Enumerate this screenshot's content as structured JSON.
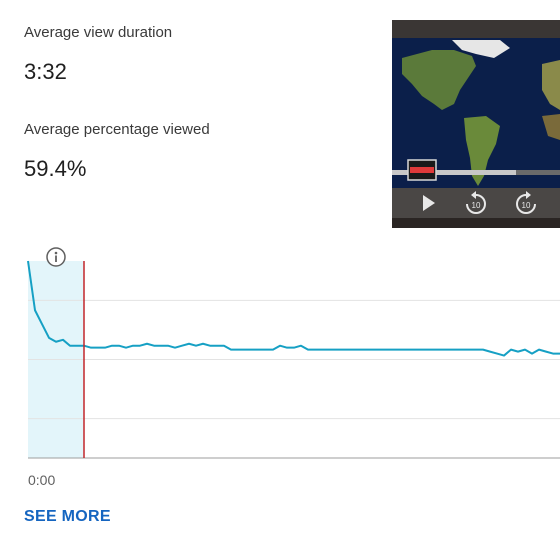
{
  "metrics": {
    "avg_view_duration_label": "Average view duration",
    "avg_view_duration_value": "3:32",
    "avg_pct_viewed_label": "Average percentage viewed",
    "avg_pct_viewed_value": "59.4%"
  },
  "chart_data": {
    "type": "line",
    "title": "",
    "xlabel": "",
    "ylabel": "",
    "x_tick_labels": [
      "0:00"
    ],
    "x": [
      0,
      1,
      2,
      3,
      4,
      5,
      6,
      7,
      8,
      9,
      10,
      11,
      12,
      13,
      14,
      15,
      16,
      17,
      18,
      19,
      20,
      21,
      22,
      23,
      24,
      25,
      26,
      27,
      28,
      29,
      30,
      31,
      32,
      33,
      34,
      35,
      36,
      37,
      38,
      39,
      40,
      41,
      42,
      43,
      44,
      45,
      46,
      47,
      48,
      49,
      50,
      51,
      52,
      53,
      54,
      55,
      56,
      57,
      58,
      59,
      60,
      61,
      62,
      63,
      64,
      65,
      66,
      67,
      68,
      69,
      70,
      71,
      72,
      73,
      74,
      75,
      76
    ],
    "series": [
      {
        "values": [
          100,
          75,
          68,
          61,
          59,
          60,
          57,
          57,
          57,
          56,
          56,
          56,
          57,
          57,
          56,
          57,
          57,
          58,
          57,
          57,
          57,
          56,
          57,
          58,
          57,
          58,
          57,
          57,
          57,
          55,
          55,
          55,
          55,
          55,
          55,
          55,
          57,
          56,
          56,
          57,
          55,
          55,
          55,
          55,
          55,
          55,
          55,
          55,
          55,
          55,
          55,
          55,
          55,
          55,
          55,
          55,
          55,
          55,
          55,
          55,
          55,
          55,
          55,
          55,
          55,
          55,
          54,
          53,
          52,
          55,
          54,
          55,
          53,
          55,
          54,
          53,
          53
        ]
      }
    ],
    "ylim": [
      0,
      100
    ],
    "grid": true,
    "highlight_region_end_index": 8,
    "marker_index": 8,
    "line_color": "#16a0c4",
    "highlight_color": "#e3f5fa",
    "marker_color": "#c2262b"
  },
  "info_icon": "info-icon",
  "see_more_label": "SEE MORE",
  "video": {
    "play_icon": "play-icon",
    "rewind_icon": "rewind-10-icon",
    "forward_icon": "forward-10-icon",
    "rewind_text": "10",
    "forward_text": "10"
  }
}
